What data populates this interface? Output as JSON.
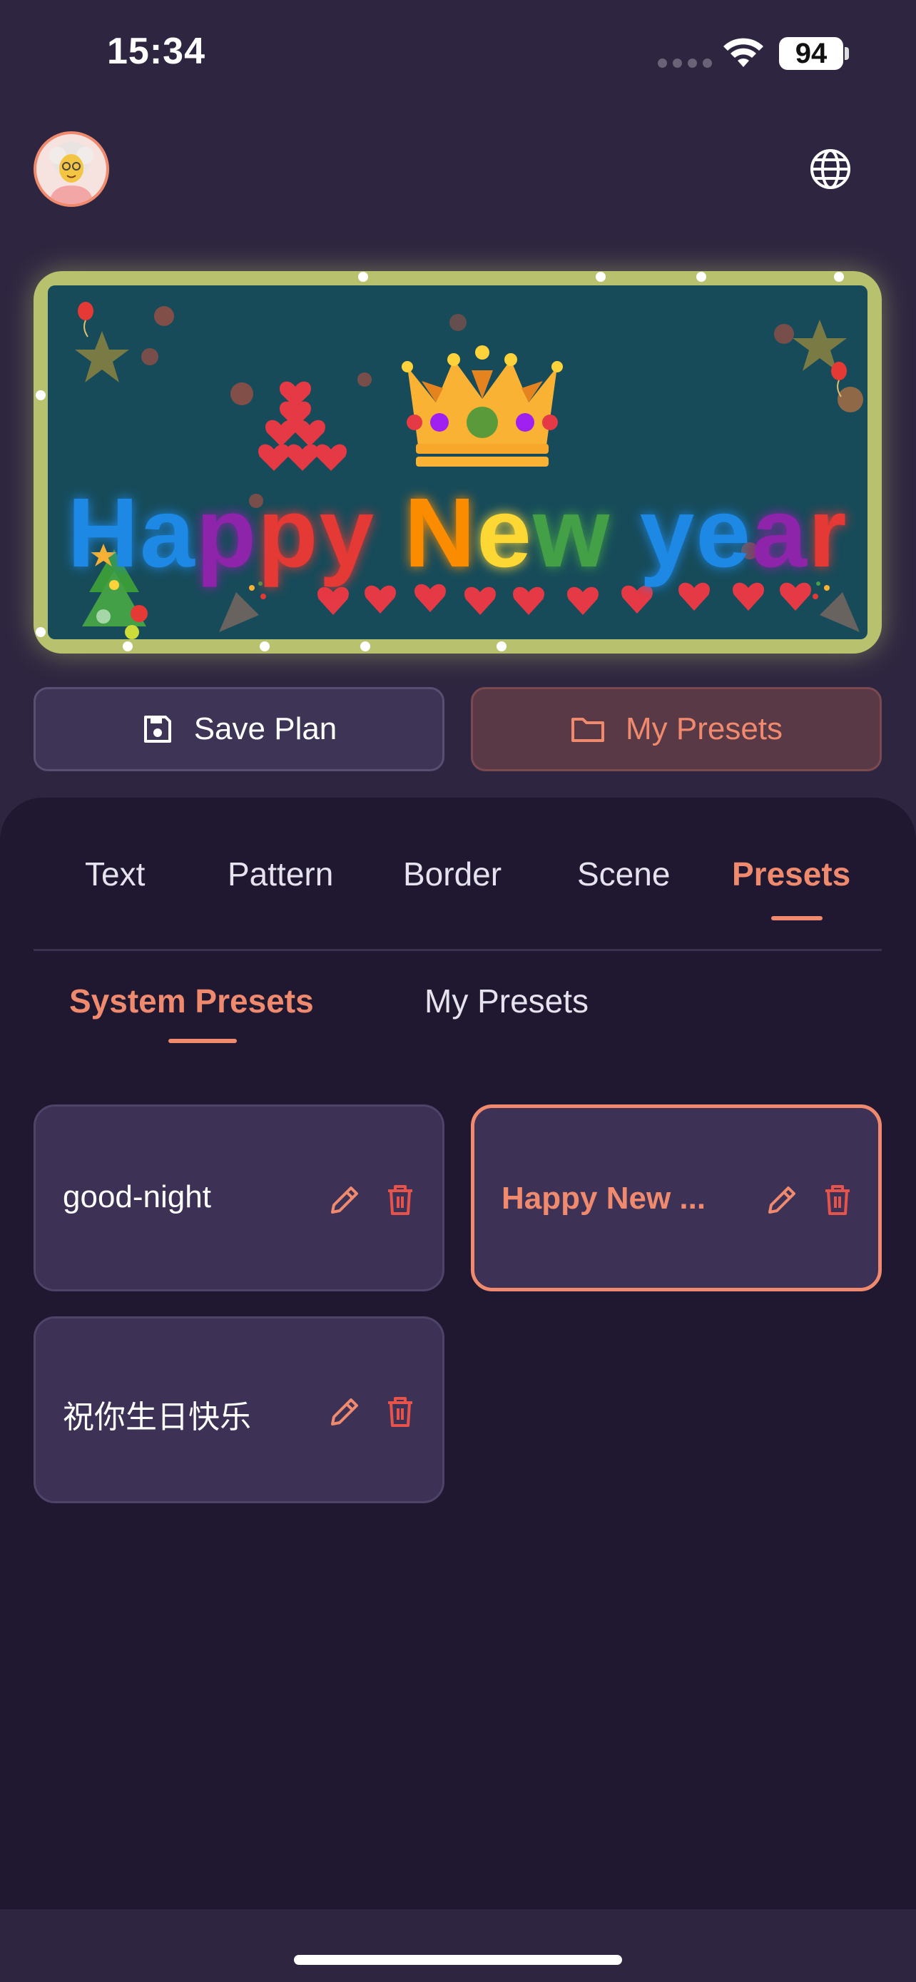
{
  "status": {
    "time": "15:34",
    "battery": "94"
  },
  "header": {
    "avatar_icon": "avatar-icon",
    "language_icon": "globe-icon"
  },
  "banner": {
    "text": "Happy New year",
    "letters": [
      {
        "ch": "H",
        "color": "#1e88e5"
      },
      {
        "ch": "a",
        "color": "#1e88e5"
      },
      {
        "ch": "p",
        "color": "#8e24aa"
      },
      {
        "ch": "p",
        "color": "#e53935"
      },
      {
        "ch": "y",
        "color": "#e53935"
      },
      {
        "ch": " ",
        "color": "#ffffff"
      },
      {
        "ch": "N",
        "color": "#fb8c00"
      },
      {
        "ch": "e",
        "color": "#fdd835"
      },
      {
        "ch": "w",
        "color": "#43a047"
      },
      {
        "ch": " ",
        "color": "#ffffff"
      },
      {
        "ch": "y",
        "color": "#1e88e5"
      },
      {
        "ch": "e",
        "color": "#1e88e5"
      },
      {
        "ch": "a",
        "color": "#8e24aa"
      },
      {
        "ch": "r",
        "color": "#e53935"
      }
    ],
    "border_color": "#b8c26e",
    "background_color": "#174b5a"
  },
  "actions": {
    "save_label": "Save Plan",
    "presets_label": "My Presets"
  },
  "tabs": {
    "items": [
      "Text",
      "Pattern",
      "Border",
      "Scene",
      "Presets"
    ],
    "active": "Presets"
  },
  "subtabs": {
    "system": "System Presets",
    "mine": "My Presets",
    "active": "System Presets"
  },
  "presets": [
    {
      "label": "good-night",
      "selected": false
    },
    {
      "label": "Happy New ...",
      "selected": true
    },
    {
      "label": "祝你生日快乐",
      "selected": false
    }
  ],
  "colors": {
    "accent": "#f08a6e",
    "background": "#2e2540",
    "panel": "#1f1830",
    "card": "#3d3256",
    "delete": "#e5534b"
  }
}
